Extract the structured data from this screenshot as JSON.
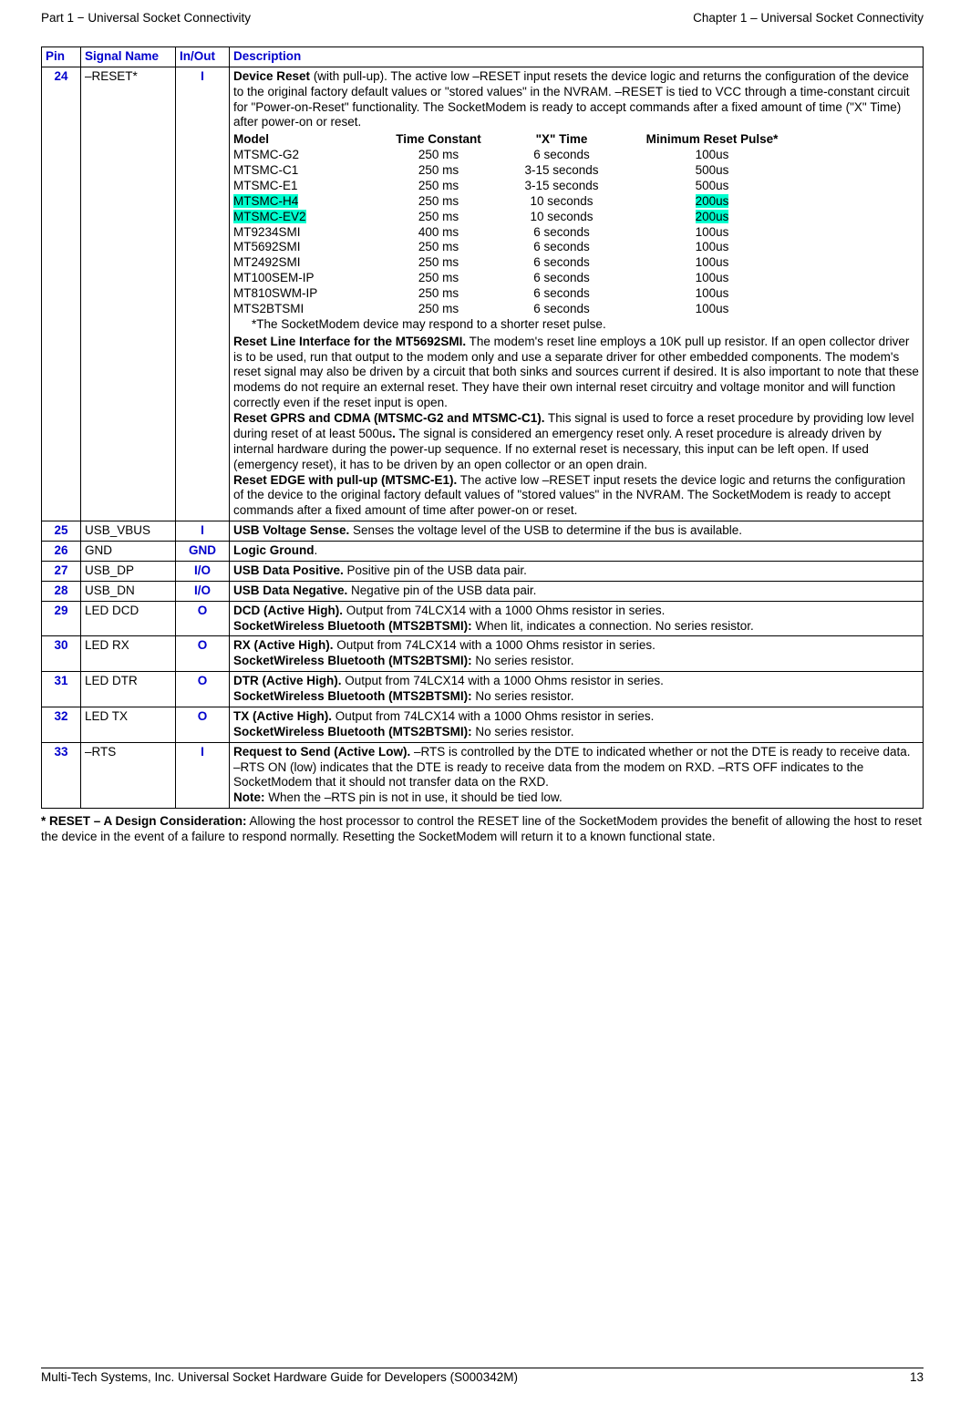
{
  "header": {
    "left": "Part 1 − Universal Socket Connectivity",
    "right": "Chapter 1 – Universal Socket Connectivity"
  },
  "columns": {
    "pin": "Pin",
    "signal": "Signal Name",
    "inout": "In/Out",
    "desc": "Description"
  },
  "row24": {
    "pin": "24",
    "signal": "–RESET*",
    "inout": "I",
    "desc_lead_bold": "Device Reset",
    "desc_lead_rest": " (with pull-up). The active low –RESET input resets the device logic and returns the configuration of the device to the original factory default values or \"stored values\" in the NVRAM.  –RESET is tied to VCC through a time-constant circuit for \"Power-on-Reset\" functionality. The SocketModem is ready to accept commands after a fixed amount of time (\"X\" Time) after power-on or reset.",
    "model_headers": [
      "Model",
      "Time Constant",
      "\"X\" Time",
      "Minimum Reset Pulse*"
    ],
    "models": [
      {
        "m": "MTSMC-G2",
        "tc": "250 ms",
        "xt": "6 seconds",
        "mrp": "100us",
        "hl": false
      },
      {
        "m": "MTSMC-C1",
        "tc": "250 ms",
        "xt": "3-15 seconds",
        "mrp": "500us",
        "hl": false
      },
      {
        "m": "MTSMC-E1",
        "tc": "250 ms",
        "xt": "3-15 seconds",
        "mrp": "500us",
        "hl": false
      },
      {
        "m": "MTSMC-H4",
        "tc": "250 ms",
        "xt": "10 seconds",
        "mrp": "200us",
        "hl": true
      },
      {
        "m": "MTSMC-EV2",
        "tc": "250 ms",
        "xt": "10 seconds",
        "mrp": "200us",
        "hl": true
      },
      {
        "m": "MT9234SMI",
        "tc": "400 ms",
        "xt": "6 seconds",
        "mrp": "100us",
        "hl": false
      },
      {
        "m": "MT5692SMI",
        "tc": "250 ms",
        "xt": "6 seconds",
        "mrp": "100us",
        "hl": false
      },
      {
        "m": "MT2492SMI",
        "tc": "250 ms",
        "xt": "6 seconds",
        "mrp": "100us",
        "hl": false
      },
      {
        "m": "MT100SEM-IP",
        "tc": "250 ms",
        "xt": "6 seconds",
        "mrp": "100us",
        "hl": false
      },
      {
        "m": "MT810SWM-IP",
        "tc": "250 ms",
        "xt": "6 seconds",
        "mrp": "100us",
        "hl": false
      },
      {
        "m": "MTS2BTSMI",
        "tc": "250 ms",
        "xt": "6 seconds",
        "mrp": "100us",
        "hl": false
      }
    ],
    "model_footnote": "*The SocketModem device may respond to a shorter reset pulse.",
    "para2_bold": "Reset Line Interface for the MT5692SMI.",
    "para2_rest": " The modem's reset line employs a 10K pull up resistor. If an open collector driver is to be used, run that output to the modem only and use a separate driver for other embedded components. The modem's reset signal may also be driven by a circuit that both sinks and sources current if desired. It is also important to note that these modems do not require an external reset. They have their own internal reset circuitry and voltage monitor and will function correctly even if the reset input is open.",
    "para3_bold": "Reset GPRS and CDMA (MTSMC-G2 and MTSMC-C1).",
    "para3_rest_a": " This signal is used to force a reset procedure by providing low level during reset of at least 500us",
    "para3_rest_b": " The signal is considered an emergency reset only. A reset procedure is already driven by internal hardware during the power-up sequence. If no external reset is necessary, this input can be left open. If used (emergency reset), it has to be driven by an open collector or an open drain.",
    "para4_bold": "Reset EDGE with pull-up (MTSMC-E1).",
    "para4_rest": " The active low –RESET input resets the device logic and returns the configuration of the device to the original factory default values of \"stored values\" in the NVRAM. The SocketModem is ready to accept commands after a fixed amount of time after power-on or reset."
  },
  "rows": [
    {
      "pin": "25",
      "signal": "USB_VBUS",
      "inout": "I",
      "desc": [
        {
          "b": "USB Voltage Sense.",
          "t": " Senses the voltage level of the USB to determine if the bus is available."
        }
      ]
    },
    {
      "pin": "26",
      "signal": "GND",
      "inout": "GND",
      "desc": [
        {
          "b": "Logic Ground",
          "t": "."
        }
      ]
    },
    {
      "pin": "27",
      "signal": "USB_DP",
      "inout": "I/O",
      "desc": [
        {
          "b": "USB Data Positive.",
          "t": " Positive pin of the USB data pair."
        }
      ]
    },
    {
      "pin": "28",
      "signal": "USB_DN",
      "inout": "I/O",
      "desc": [
        {
          "b": "USB Data Negative.",
          "t": " Negative pin of the USB data pair."
        }
      ]
    },
    {
      "pin": "29",
      "signal": "LED DCD",
      "inout": "O",
      "desc": [
        {
          "b": "DCD (Active High).",
          "t": " Output from 74LCX14 with a 1000 Ohms resistor in series."
        },
        {
          "b": "SocketWireless Bluetooth (MTS2BTSMI):",
          "t": " When lit, indicates a connection. No series resistor."
        }
      ]
    },
    {
      "pin": "30",
      "signal": "LED RX",
      "inout": "O",
      "desc": [
        {
          "b": "RX (Active High).",
          "t": " Output from 74LCX14 with a 1000 Ohms resistor in series."
        },
        {
          "b": "SocketWireless Bluetooth (MTS2BTSMI):",
          "t": " No series resistor."
        }
      ]
    },
    {
      "pin": "31",
      "signal": "LED DTR",
      "inout": "O",
      "desc": [
        {
          "b": "DTR (Active High).",
          "t": " Output from 74LCX14 with a 1000 Ohms resistor in series."
        },
        {
          "b": "SocketWireless Bluetooth (MTS2BTSMI):",
          "t": " No series resistor."
        }
      ]
    },
    {
      "pin": "32",
      "signal": "LED TX",
      "inout": "O",
      "desc": [
        {
          "b": "TX (Active High).",
          "t": " Output from 74LCX14 with a 1000 Ohms resistor in series."
        },
        {
          "b": "SocketWireless Bluetooth (MTS2BTSMI):",
          "t": " No series resistor."
        }
      ]
    },
    {
      "pin": "33",
      "signal": "–RTS",
      "inout": "I",
      "desc": [
        {
          "b": "Request to Send (Active Low).",
          "t": " –RTS is controlled by the DTE to indicated whether or not the DTE is ready to receive data. –RTS ON (low) indicates that the DTE is ready to receive data from the modem on RXD. –RTS OFF indicates to the SocketModem that it should not transfer data on the RXD."
        },
        {
          "b": "Note:",
          "t": " When the –RTS pin is not in use, it should be tied low."
        }
      ]
    }
  ],
  "design_note": {
    "bold": "* RESET – A Design Consideration:",
    "rest": " Allowing the host processor to control the RESET line of the SocketModem provides the benefit of allowing the host to reset the device in the event of a failure to respond normally. Resetting the SocketModem will return it to a known functional state."
  },
  "footer": {
    "left": "Multi-Tech Systems, Inc. Universal Socket Hardware Guide for Developers (S000342M)",
    "right": "13"
  }
}
